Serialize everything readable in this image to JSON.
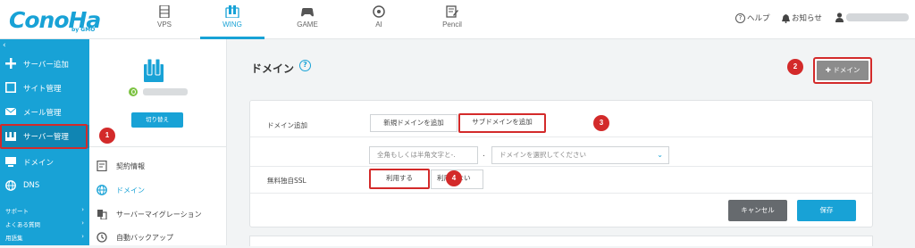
{
  "header": {
    "logo": "ConoHa",
    "logo_sub": "by GMO",
    "tabs": [
      {
        "label": "VPS",
        "icon": "server-icon"
      },
      {
        "label": "WING",
        "icon": "wing-icon",
        "active": true
      },
      {
        "label": "GAME",
        "icon": "gamepad-icon"
      },
      {
        "label": "AI",
        "icon": "ai-icon"
      },
      {
        "label": "Pencil",
        "icon": "pencil-icon"
      }
    ],
    "help": "ヘルプ",
    "notifications": "お知らせ"
  },
  "sidebar": {
    "items": [
      {
        "label": "サーバー追加",
        "icon": "plus-icon"
      },
      {
        "label": "サイト管理",
        "icon": "site-icon"
      },
      {
        "label": "メール管理",
        "icon": "mail-icon"
      },
      {
        "label": "サーバー管理",
        "icon": "server-manage-icon",
        "active": true
      },
      {
        "label": "ドメイン",
        "icon": "domain-icon"
      },
      {
        "label": "DNS",
        "icon": "globe-icon"
      }
    ],
    "sub_items": [
      {
        "label": "サポート"
      },
      {
        "label": "よくある質問"
      },
      {
        "label": "用語集"
      }
    ]
  },
  "server_panel": {
    "switch_label": "切り替え",
    "menu": [
      {
        "label": "契約情報",
        "icon": "contract-icon"
      },
      {
        "label": "ドメイン",
        "icon": "globe-icon",
        "active": true
      },
      {
        "label": "サーバーマイグレーション",
        "icon": "migration-icon"
      },
      {
        "label": "自動バックアップ",
        "icon": "backup-icon"
      }
    ]
  },
  "main": {
    "title": "ドメイン",
    "add_domain_button": "ドメイン",
    "form": {
      "domain_add_label": "ドメイン追加",
      "new_domain_button": "新規ドメインを追加",
      "subdomain_button": "サブドメインを追加",
      "subdomain_placeholder": "全角もしくは半角文字と-.",
      "separator": ".",
      "domain_select_placeholder": "ドメインを選択してください",
      "ssl_label": "無料独自SSL",
      "ssl_use": "利用する",
      "ssl_not_use": "利用しない"
    },
    "cancel_button": "キャンセル",
    "save_button": "保存"
  },
  "annotations": {
    "step1": "1",
    "step2": "2",
    "step3": "3",
    "step4": "4"
  },
  "colors": {
    "accent": "#18a2d6",
    "highlight": "#d32a2a",
    "sidebar_active": "#1085b3"
  }
}
